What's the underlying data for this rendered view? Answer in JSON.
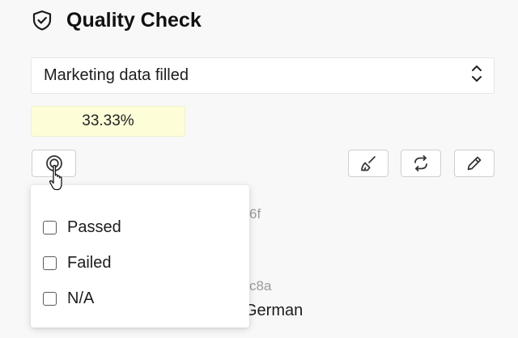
{
  "header": {
    "title": "Quality Check",
    "icon": "shield-check-icon"
  },
  "status_select": {
    "value": "Marketing data filled",
    "icon": "chevron-up-down-icon"
  },
  "progress": {
    "label": "33.33%",
    "value_percent": 33.33,
    "color": "#fdfdd8"
  },
  "toolbar": {
    "filter_icon": "target-icon",
    "clean_icon": "broom-icon",
    "sync_icon": "refresh-icon",
    "edit_icon": "pencil-icon"
  },
  "background": {
    "id_fragment_1": "6f",
    "id_fragment_2": "c8a",
    "language": "German"
  },
  "filter_dropdown": {
    "options": [
      {
        "label": "Passed",
        "checked": false
      },
      {
        "label": "Failed",
        "checked": false
      },
      {
        "label": "N/A",
        "checked": false
      }
    ]
  }
}
